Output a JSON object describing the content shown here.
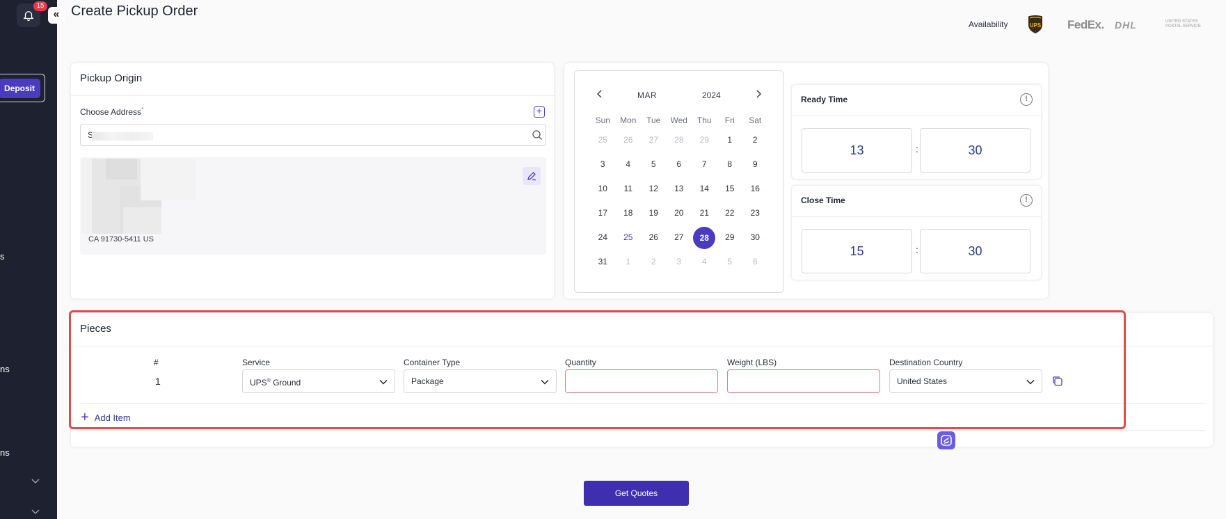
{
  "sidebar": {
    "notification_count": "15",
    "deposit_label": "Deposit",
    "fragments": [
      "s",
      "ns",
      "ns"
    ]
  },
  "header": {
    "title": "Create Pickup Order",
    "availability_label": "Availability",
    "carriers": {
      "ups": "UPS",
      "fedex": "FedEx.",
      "dhl": "DHL",
      "usps": "UNITED STATES POSTAL SERVICE"
    }
  },
  "pickup_origin": {
    "title": "Pickup Origin",
    "choose_address_label": "Choose Address",
    "required_mark": "*",
    "address_input_value": "S",
    "address_line": "CA 91730-5411 US"
  },
  "calendar": {
    "month": "MAR",
    "year": "2024",
    "prev_icon": "chevron-left-icon",
    "next_icon": "chevron-right-icon",
    "weekdays": [
      "Sun",
      "Mon",
      "Tue",
      "Wed",
      "Thu",
      "Fri",
      "Sat"
    ],
    "weeks": [
      [
        {
          "d": "25",
          "m": true
        },
        {
          "d": "26",
          "m": true
        },
        {
          "d": "27",
          "m": true
        },
        {
          "d": "28",
          "m": true
        },
        {
          "d": "29",
          "m": true
        },
        {
          "d": "1"
        },
        {
          "d": "2"
        }
      ],
      [
        {
          "d": "3"
        },
        {
          "d": "4"
        },
        {
          "d": "5"
        },
        {
          "d": "6"
        },
        {
          "d": "7"
        },
        {
          "d": "8"
        },
        {
          "d": "9"
        }
      ],
      [
        {
          "d": "10"
        },
        {
          "d": "11"
        },
        {
          "d": "12"
        },
        {
          "d": "13"
        },
        {
          "d": "14"
        },
        {
          "d": "15"
        },
        {
          "d": "16"
        }
      ],
      [
        {
          "d": "17"
        },
        {
          "d": "18"
        },
        {
          "d": "19"
        },
        {
          "d": "20"
        },
        {
          "d": "21"
        },
        {
          "d": "22"
        },
        {
          "d": "23"
        }
      ],
      [
        {
          "d": "24"
        },
        {
          "d": "25",
          "today": true
        },
        {
          "d": "26"
        },
        {
          "d": "27"
        },
        {
          "d": "28",
          "sel": true
        },
        {
          "d": "29"
        },
        {
          "d": "30"
        }
      ],
      [
        {
          "d": "31"
        },
        {
          "d": "1",
          "m": true
        },
        {
          "d": "2",
          "m": true
        },
        {
          "d": "3",
          "m": true
        },
        {
          "d": "4",
          "m": true
        },
        {
          "d": "5",
          "m": true
        },
        {
          "d": "6",
          "m": true
        }
      ]
    ]
  },
  "ready_time": {
    "title": "Ready Time",
    "hour": "13",
    "minute": "30",
    "separator": ":"
  },
  "close_time": {
    "title": "Close Time",
    "hour": "15",
    "minute": "30",
    "separator": ":"
  },
  "pieces": {
    "title": "Pieces",
    "columns": {
      "num": "#",
      "service": "Service",
      "container": "Container Type",
      "quantity": "Quantity",
      "weight": "Weight (LBS)",
      "country": "Destination Country"
    },
    "row": {
      "num": "1",
      "service": "UPS",
      "service_mark": "®",
      "service_suffix": " Ground",
      "container": "Package",
      "quantity": "",
      "weight": "",
      "country": "United States"
    },
    "add_item_label": "Add Item"
  },
  "actions": {
    "get_quotes_label": "Get Quotes"
  },
  "colors": {
    "accent": "#4b3bbf",
    "sidebar_bg": "#1e2130",
    "highlight": "#e24a4a",
    "badge": "#e5394a"
  }
}
